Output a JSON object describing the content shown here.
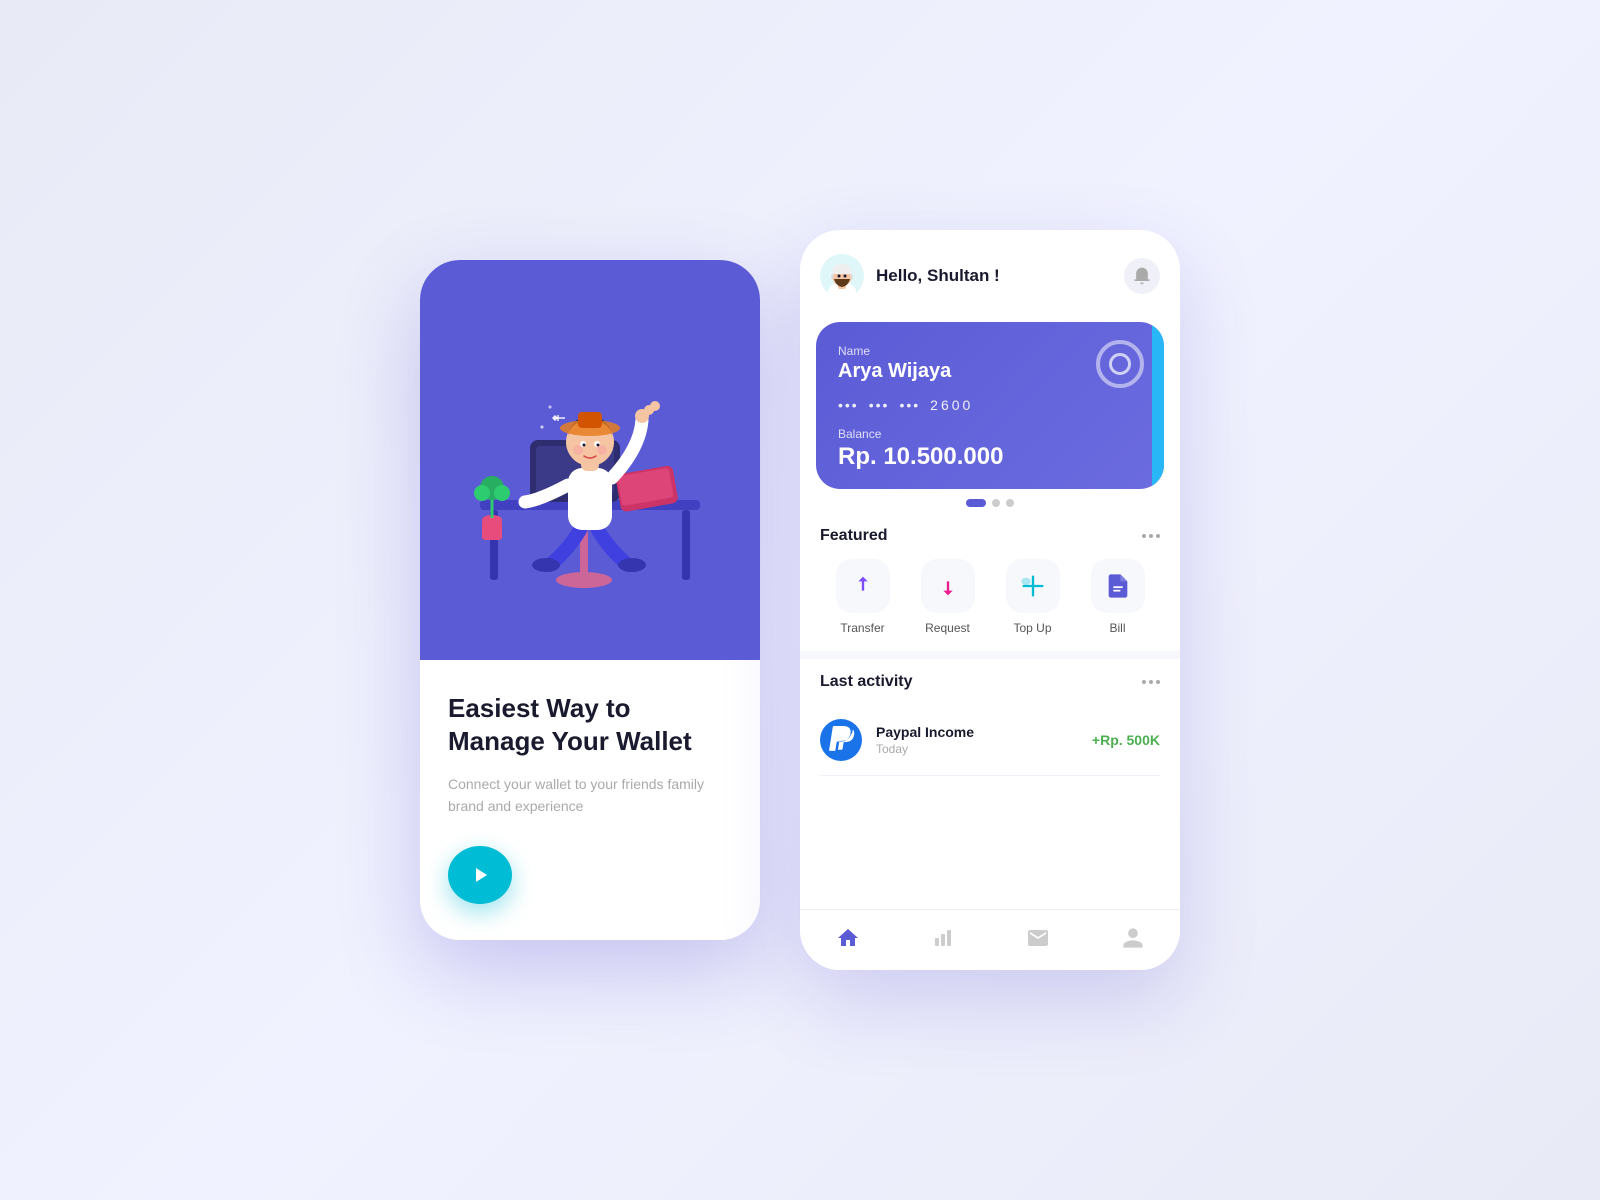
{
  "background": "#eef0fb",
  "left_phone": {
    "title": "Easiest Way to Manage Your Wallet",
    "subtitle": "Connect your wallet to your friends family brand and experience",
    "play_button_label": "▶"
  },
  "right_phone": {
    "greeting": "Hello, Shultan !",
    "card": {
      "name_label": "Name",
      "name": "Arya Wijaya",
      "number_dots": "···  ···  ···",
      "number_last": "2600",
      "balance_label": "Balance",
      "balance": "Rp. 10.500.000"
    },
    "featured": {
      "title": "Featured",
      "items": [
        {
          "label": "Transfer",
          "color": "#7c4dff"
        },
        {
          "label": "Request",
          "color": "#e91e8c"
        },
        {
          "label": "Top Up",
          "color": "#00bcd4"
        },
        {
          "label": "Bill",
          "color": "#5b5bd6"
        }
      ]
    },
    "last_activity": {
      "title": "Last activity",
      "items": [
        {
          "name": "Paypal Income",
          "date": "Today",
          "amount": "+Rp. 500K",
          "amount_color": "#4caf50"
        }
      ]
    },
    "nav": [
      "Home",
      "Chart",
      "Message",
      "Profile"
    ]
  }
}
